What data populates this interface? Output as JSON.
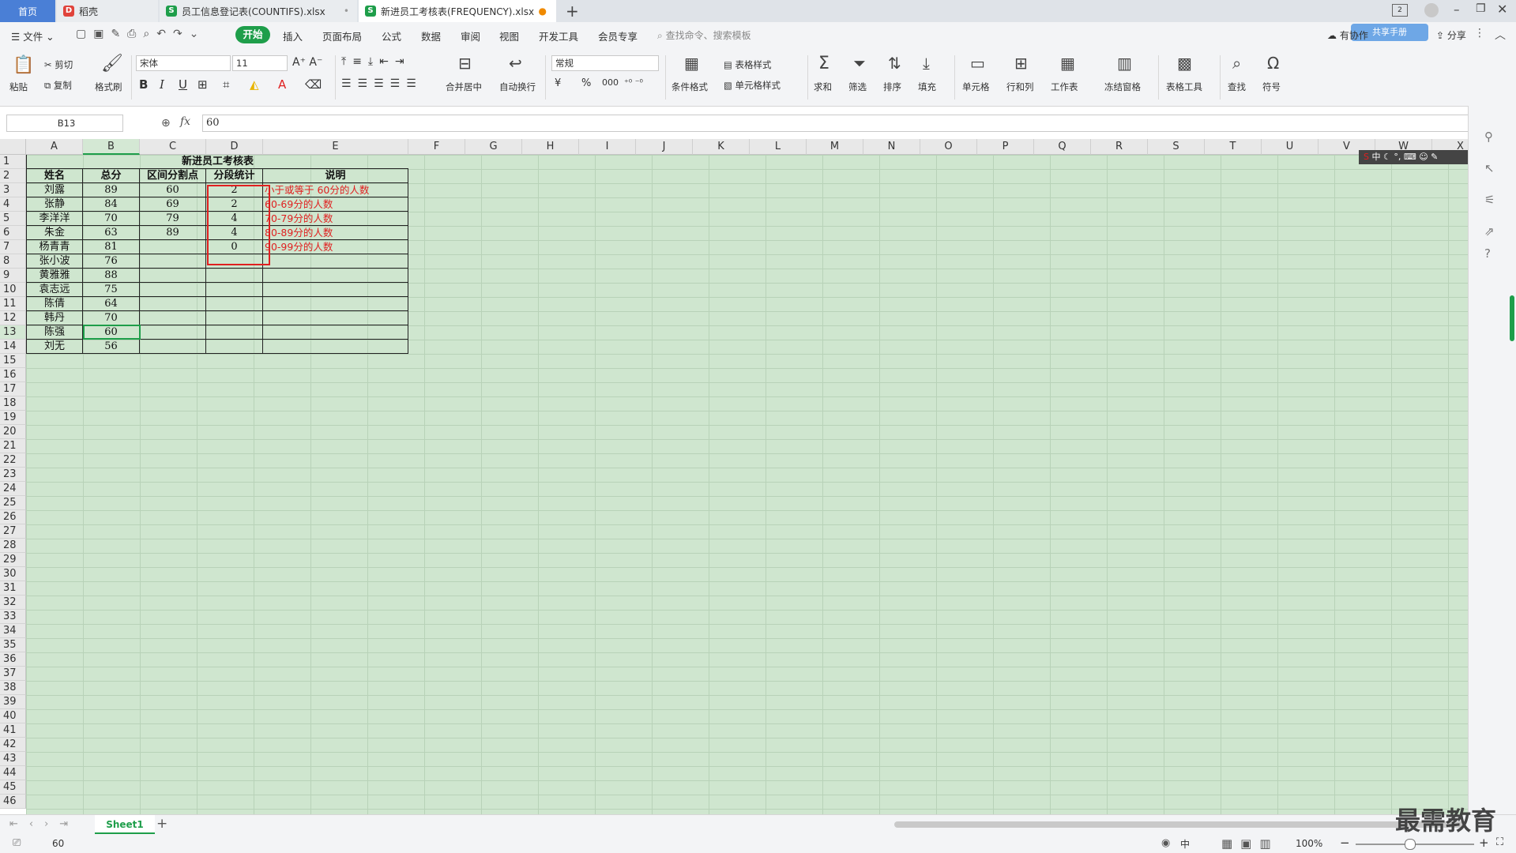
{
  "tabs": [
    {
      "label": "首页",
      "active": false
    },
    {
      "label": "稻壳",
      "active": false
    },
    {
      "label": "员工信息登记表(COUNTIFS).xlsx",
      "active": false
    },
    {
      "label": "新进员工考核表(FREQUENCY).xlsx",
      "active": true
    }
  ],
  "menu": {
    "file": "文件",
    "items": [
      "开始",
      "插入",
      "页面布局",
      "公式",
      "数据",
      "审阅",
      "视图",
      "开发工具",
      "会员专享"
    ],
    "search_placeholder": "查找命令、搜索模板",
    "collab": "有协作",
    "share": "分享",
    "badge": "共享手册"
  },
  "ribbon": {
    "paste": "粘贴",
    "cut": "剪切",
    "copy": "复制",
    "format_painter": "格式刷",
    "font_name": "宋体",
    "font_size": "11",
    "merge_center": "合并居中",
    "wrap_text": "自动换行",
    "number_format": "常规",
    "cond_format": "条件格式",
    "table_style": "表格样式",
    "cell_style": "单元格样式",
    "sum": "求和",
    "filter": "筛选",
    "sort": "排序",
    "fill": "填充",
    "cells": "单元格",
    "row_col": "行和列",
    "worksheet": "工作表",
    "freeze": "冻结窗格",
    "table_tools": "表格工具",
    "find": "查找",
    "symbol": "符号",
    "currency": "¥",
    "percent": "%",
    "thousands": "000"
  },
  "formula_bar": {
    "name_box": "B13",
    "fx": "fx",
    "value": "60"
  },
  "columns": [
    "A",
    "B",
    "C",
    "D",
    "E",
    "F",
    "G",
    "H",
    "I",
    "J",
    "K",
    "L",
    "M",
    "N",
    "O",
    "P",
    "Q",
    "R",
    "S",
    "T",
    "U",
    "V",
    "W",
    "X"
  ],
  "row_count": 46,
  "sheet": {
    "title": "新进员工考核表",
    "headers": [
      "姓名",
      "总分",
      "区间分割点",
      "分段统计",
      "说明"
    ],
    "rows": [
      [
        "刘露",
        "89",
        "60",
        "2",
        "小于或等于 60分的人数"
      ],
      [
        "张静",
        "84",
        "69",
        "2",
        "60-69分的人数"
      ],
      [
        "李洋洋",
        "70",
        "79",
        "4",
        "70-79分的人数"
      ],
      [
        "朱金",
        "63",
        "89",
        "4",
        "80-89分的人数"
      ],
      [
        "杨青青",
        "81",
        "",
        "0",
        "90-99分的人数"
      ],
      [
        "张小波",
        "76",
        "",
        "",
        ""
      ],
      [
        "黄雅雅",
        "88",
        "",
        "",
        ""
      ],
      [
        "袁志远",
        "75",
        "",
        "",
        ""
      ],
      [
        "陈倩",
        "64",
        "",
        "",
        ""
      ],
      [
        "韩丹",
        "70",
        "",
        "",
        ""
      ],
      [
        "陈强",
        "60",
        "",
        "",
        ""
      ],
      [
        "刘无",
        "56",
        "",
        "",
        ""
      ]
    ]
  },
  "sheet_tabs": [
    "Sheet1"
  ],
  "status": {
    "value": "60",
    "zoom": "100%",
    "ime": "中"
  },
  "watermark": "最需教育",
  "colors": {
    "grid_bg": "#cfe6cf",
    "accent": "#1e9e4a",
    "note_red": "#e02020",
    "highlight_box": "#e02020"
  }
}
